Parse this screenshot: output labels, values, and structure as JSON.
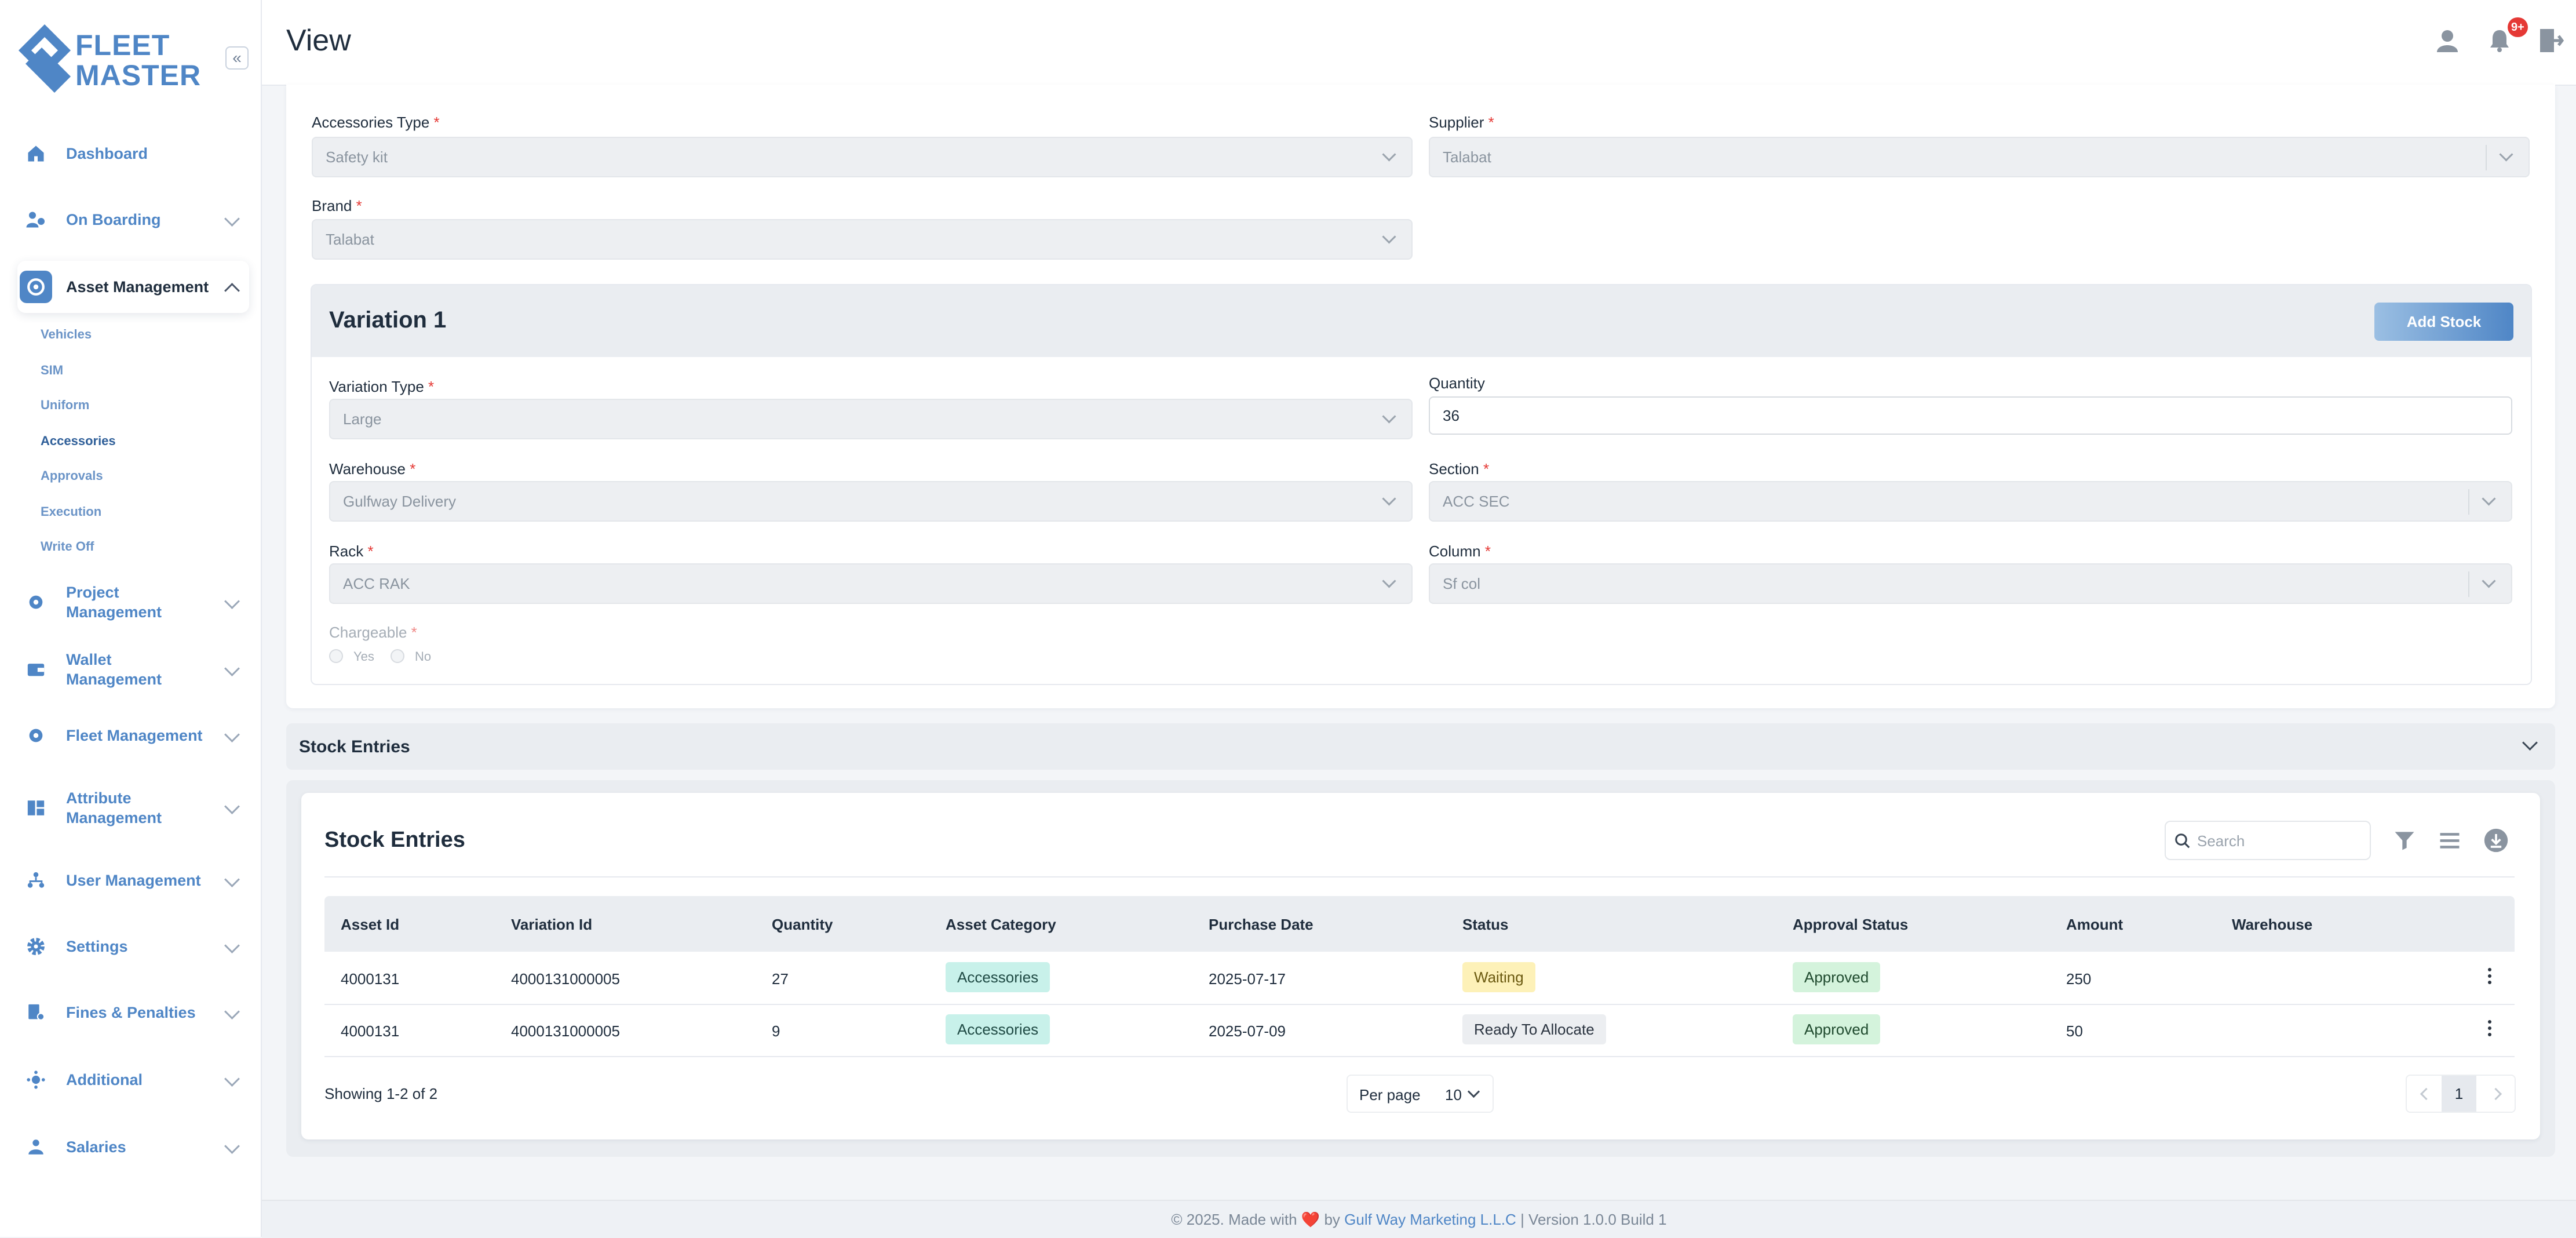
{
  "brand": {
    "line1": "FLEET",
    "line2": "MASTER",
    "accent": "#4f86c6"
  },
  "sidebar": {
    "collapse_icon": "«",
    "items": [
      {
        "label": "Dashboard",
        "icon": "home-icon"
      },
      {
        "label": "On Boarding",
        "icon": "onboarding-icon"
      },
      {
        "label": "Asset Management",
        "icon": "asset-icon"
      },
      {
        "label": "Project Management",
        "icon": "project-icon"
      },
      {
        "label": "Wallet Management",
        "icon": "wallet-icon"
      },
      {
        "label": "Fleet Management",
        "icon": "fleet-icon"
      },
      {
        "label": "Attribute Management",
        "icon": "attribute-icon"
      },
      {
        "label": "User Management",
        "icon": "users-icon"
      },
      {
        "label": "Settings",
        "icon": "gear-icon"
      },
      {
        "label": "Fines & Penalties",
        "icon": "fines-icon"
      },
      {
        "label": "Additional",
        "icon": "additional-icon"
      },
      {
        "label": "Salaries",
        "icon": "salaries-icon"
      }
    ],
    "asset_submenu": [
      "Vehicles",
      "SIM",
      "Uniform",
      "Accessories",
      "Approvals",
      "Execution",
      "Write Off"
    ]
  },
  "header": {
    "title": "View",
    "notification_badge": "9+"
  },
  "form": {
    "accessories_type": {
      "label": "Accessories Type",
      "required": "*",
      "value": "Safety kit"
    },
    "supplier": {
      "label": "Supplier",
      "required": "*",
      "value": "Talabat"
    },
    "brand": {
      "label": "Brand",
      "required": "*",
      "value": "Talabat"
    }
  },
  "variation": {
    "title": "Variation 1",
    "add_stock": "Add Stock",
    "variation_type": {
      "label": "Variation Type",
      "required": "*",
      "value": "Large"
    },
    "quantity": {
      "label": "Quantity",
      "value": "36"
    },
    "warehouse": {
      "label": "Warehouse",
      "required": "*",
      "value": "Gulfway Delivery"
    },
    "section": {
      "label": "Section",
      "required": "*",
      "value": "ACC SEC"
    },
    "rack": {
      "label": "Rack",
      "required": "*",
      "value": "ACC RAK"
    },
    "column": {
      "label": "Column",
      "required": "*",
      "value": "Sf col"
    },
    "chargeable": {
      "label": "Chargeable",
      "required": "*",
      "yes": "Yes",
      "no": "No"
    }
  },
  "stock_section": {
    "title": "Stock Entries"
  },
  "table": {
    "title": "Stock Entries",
    "search_placeholder": "Search",
    "columns": [
      "Asset Id",
      "Variation Id",
      "Quantity",
      "Asset Category",
      "Purchase Date",
      "Status",
      "Approval Status",
      "Amount",
      "Warehouse"
    ],
    "rows": [
      {
        "asset_id": "4000131",
        "variation_id": "4000131000005",
        "quantity": "27",
        "category": "Accessories",
        "purchase_date": "2025-07-17",
        "status": "Waiting",
        "approval": "Approved",
        "amount": "250",
        "warehouse": ""
      },
      {
        "asset_id": "4000131",
        "variation_id": "4000131000005",
        "quantity": "9",
        "category": "Accessories",
        "purchase_date": "2025-07-09",
        "status": "Ready To Allocate",
        "approval": "Approved",
        "amount": "50",
        "warehouse": ""
      }
    ],
    "showing": "Showing 1-2 of 2",
    "per_page_label": "Per page",
    "per_page_value": "10",
    "current_page": "1"
  },
  "footer": {
    "prefix": "© 2025. Made with",
    "heart": "❤️",
    "by": "by",
    "company": "Gulf Way Marketing L.L.C",
    "version": "| Version 1.0.0 Build 1"
  }
}
